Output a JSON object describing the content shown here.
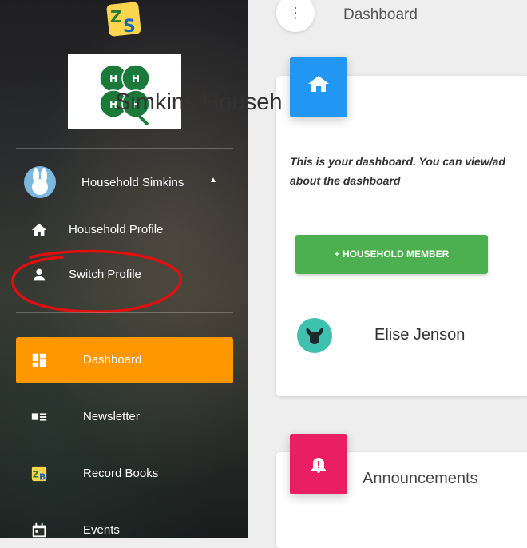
{
  "sidebar": {
    "user": {
      "name": "Household Simkins",
      "caret": "▲"
    },
    "profile_menu": [
      {
        "label": "Household Profile",
        "icon": "home-icon"
      },
      {
        "label": "Switch Profile",
        "icon": "person-icon"
      }
    ],
    "nav": [
      {
        "label": "Dashboard",
        "icon": "dashboard-icon",
        "active": true
      },
      {
        "label": "Newsletter",
        "icon": "newsletter-icon",
        "active": false
      },
      {
        "label": "Record Books",
        "icon": "record-books-icon",
        "active": false
      },
      {
        "label": "Events",
        "icon": "calendar-icon",
        "active": false
      }
    ]
  },
  "header": {
    "menu_icon": "⋮",
    "title": "Dashboard"
  },
  "household_card": {
    "title": "Simkins Househ",
    "description_line1": "This is your dashboard. You can view/ad",
    "description_line2": "about the dashboard",
    "add_button": "+ HOUSEHOLD MEMBER",
    "members": [
      {
        "name": "Elise Jenson"
      }
    ]
  },
  "announcements_card": {
    "title": "Announcements"
  },
  "colors": {
    "accent": "#ff9800",
    "home_icon_bg": "#2196f3",
    "announcement_icon_bg": "#e91e63",
    "add_button": "#4caf50",
    "annotation": "#e01010"
  }
}
